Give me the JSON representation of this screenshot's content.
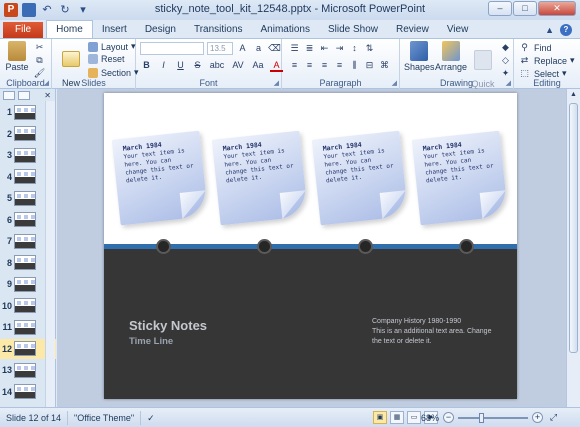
{
  "window": {
    "title": "sticky_note_tool_kit_12548.pptx - Microsoft PowerPoint",
    "app_icon_letter": "P",
    "min": "–",
    "max": "□",
    "close": "✕"
  },
  "tabs": [
    "File",
    "Home",
    "Insert",
    "Design",
    "Transitions",
    "Animations",
    "Slide Show",
    "Review",
    "View"
  ],
  "active_tab": "Home",
  "ribbon": {
    "clipboard": {
      "label": "Clipboard",
      "paste": "Paste"
    },
    "slides": {
      "label": "Slides",
      "new_slide": "New\nSlide",
      "layout": "Layout",
      "reset": "Reset",
      "section": "Section"
    },
    "font": {
      "label": "Font",
      "font_name": "",
      "font_size": "13.5",
      "bold": "B",
      "italic": "I",
      "underline": "U",
      "strike": "S",
      "shadow": "abc",
      "spacing": "AV",
      "case": "Aa",
      "color": "A"
    },
    "paragraph": {
      "label": "Paragraph"
    },
    "drawing": {
      "label": "Drawing",
      "shapes": "Shapes",
      "arrange": "Arrange",
      "quick_styles": "Quick\nStyles"
    },
    "editing": {
      "label": "Editing",
      "find": "Find",
      "replace": "Replace",
      "select": "Select"
    }
  },
  "thumbnails": {
    "items": [
      "1",
      "2",
      "3",
      "4",
      "5",
      "6",
      "7",
      "8",
      "9",
      "10",
      "11",
      "12",
      "13",
      "14"
    ],
    "selected": "12"
  },
  "slide": {
    "notes": [
      {
        "title": "March 1984",
        "text": "Your text item is here. You can change this text or delete it."
      },
      {
        "title": "March 1984",
        "text": "Your text item is here. You can change this text or delete it."
      },
      {
        "title": "March 1984",
        "text": "Your text item is here. You can change this text or delete it."
      },
      {
        "title": "March 1984",
        "text": "Your text item is here. You can change this text or delete it."
      }
    ],
    "title": "Sticky Notes",
    "subtitle": "Time Line",
    "right_heading": "Company History 1980-1990",
    "right_text": "This is an additional text area. Change the text or delete it."
  },
  "status": {
    "slide_info": "Slide 12 of 14",
    "theme": "\"Office Theme\"",
    "zoom": "68%",
    "zoom_level_percent": 68
  },
  "colors": {
    "accent": "#2f6fae",
    "dark_band": "#363636",
    "file_tab": "#c3391b"
  }
}
